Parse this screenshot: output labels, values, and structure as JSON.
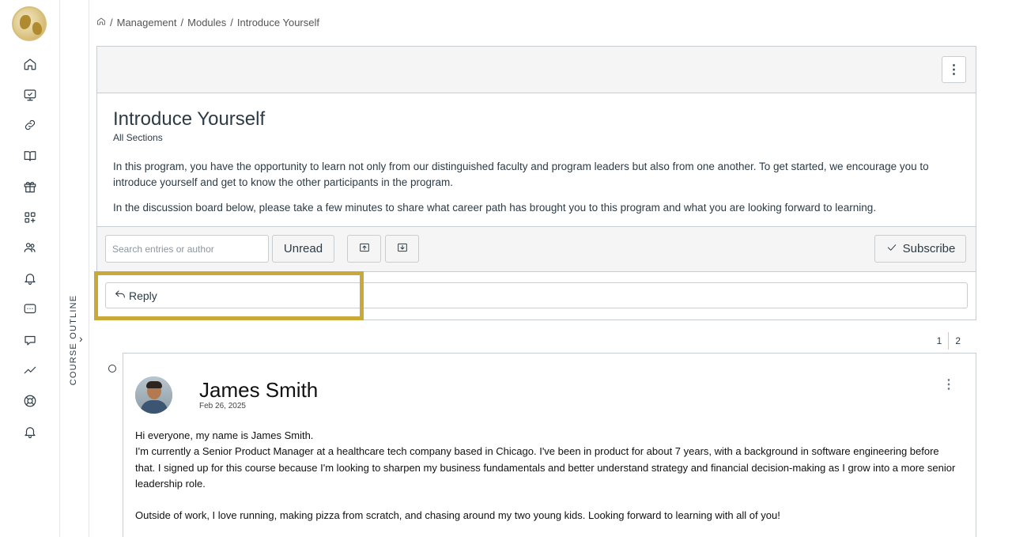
{
  "breadcrumb": {
    "items": [
      "Management",
      "Modules",
      "Introduce Yourself"
    ]
  },
  "sidebar": {
    "items": [
      "home-icon",
      "dashboard-icon",
      "link-icon",
      "book-icon",
      "gift-icon",
      "apps-icon",
      "people-icon",
      "bell-icon",
      "chat-icon",
      "inbox-icon",
      "trend-icon",
      "help-icon",
      "notification-icon"
    ]
  },
  "course_outline": {
    "label": "COURSE OUTLINE"
  },
  "topic": {
    "title": "Introduce Yourself",
    "sections": "All Sections",
    "paragraph1": "In this program, you have the opportunity to learn not only from our distinguished faculty and program leaders but also from one another. To get started, we encourage you to introduce yourself and get to know the other participants in the program.",
    "paragraph2": "In the discussion board below, please take a few minutes to share what career path has brought you to this program and what you are looking forward to learning."
  },
  "toolbar": {
    "search_placeholder": "Search entries or author",
    "unread_label": "Unread",
    "subscribe_label": "Subscribe"
  },
  "reply": {
    "label": "Reply"
  },
  "pagination": {
    "pages": [
      "1",
      "2"
    ]
  },
  "entry": {
    "author": "James Smith",
    "date": "Feb 26, 2025",
    "line1": "Hi everyone, my name is James Smith.",
    "line2": "I'm currently a Senior Product Manager at a healthcare tech company based in Chicago. I've been in product for about 7 years, with a background in software engineering before that. I signed up for this course because I'm looking to sharpen my business fundamentals and better understand strategy and financial decision-making as I grow into a more senior leadership role.",
    "line3": "Outside of work, I love running, making pizza from scratch, and chasing around my two young kids. Looking forward to learning with all of you!"
  },
  "colors": {
    "highlight": "#c9a93a",
    "text": "#2d3b45",
    "border": "#c7cdd1"
  }
}
